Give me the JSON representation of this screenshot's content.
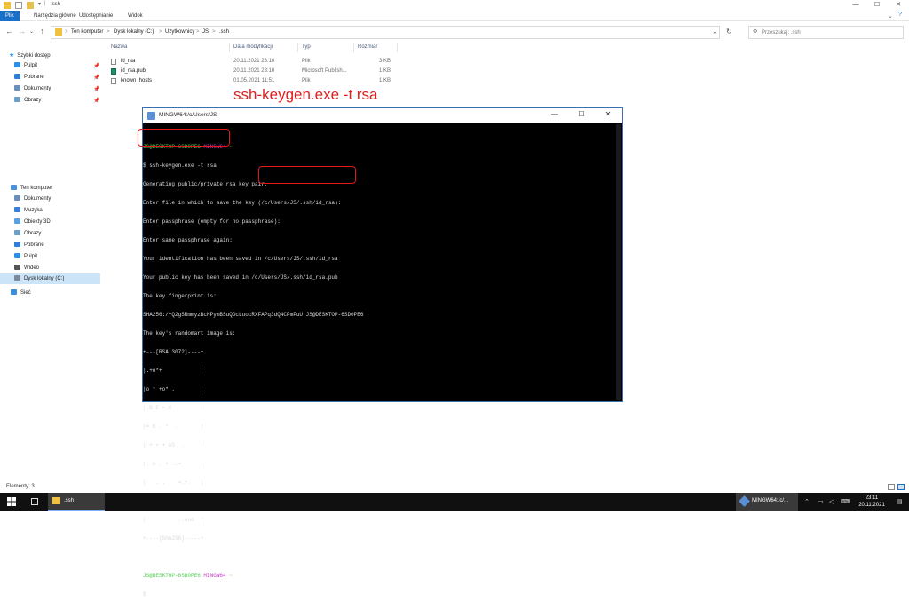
{
  "window": {
    "title": ".ssh",
    "controls": [
      "—",
      "☐",
      "✕"
    ]
  },
  "ribbon": {
    "tabs": [
      "Plik",
      "Narzędzia główne",
      "Udostępnianie",
      "Widok"
    ]
  },
  "address": {
    "crumbs": [
      "Ten komputer",
      "Dysk lokalny (C:)",
      "Użytkownicy",
      "JS",
      ".ssh"
    ],
    "separator": ">",
    "search_placeholder": "Przeszukaj: .ssh"
  },
  "sidebar": {
    "quick_access_label": "Szybki dostęp",
    "quick_access": [
      {
        "label": "Pulpit",
        "icon": "desktop-icon",
        "color": "#2f8fe8",
        "pinned": true
      },
      {
        "label": "Pobrane",
        "icon": "download-icon",
        "color": "#2f7fd8",
        "pinned": true
      },
      {
        "label": "Dokumenty",
        "icon": "documents-icon",
        "color": "#6a8fb8",
        "pinned": true
      },
      {
        "label": "Obrazy",
        "icon": "pictures-icon",
        "color": "#6a9fc8",
        "pinned": true
      }
    ],
    "pin_glyph": "📌",
    "this_pc_label": "Ten komputer",
    "this_pc": [
      {
        "label": "Dokumenty",
        "icon": "documents-icon",
        "color": "#6a8fb8"
      },
      {
        "label": "Muzyka",
        "icon": "music-icon",
        "color": "#3a7fd8"
      },
      {
        "label": "Obiekty 3D",
        "icon": "objects-3d-icon",
        "color": "#5aa0e0"
      },
      {
        "label": "Obrazy",
        "icon": "pictures-icon",
        "color": "#6a9fc8"
      },
      {
        "label": "Pobrane",
        "icon": "download-icon",
        "color": "#2f7fd8"
      },
      {
        "label": "Pulpit",
        "icon": "desktop-icon",
        "color": "#2f8fe8"
      },
      {
        "label": "Wideo",
        "icon": "video-icon",
        "color": "#555555"
      },
      {
        "label": "Dysk lokalny (C:)",
        "icon": "drive-icon",
        "color": "#7a8a9a",
        "selected": true
      }
    ],
    "network_label": "Sieć"
  },
  "files": {
    "columns": [
      "Nazwa",
      "Data modyfikacji",
      "Typ",
      "Rozmiar"
    ],
    "rows": [
      {
        "name": "id_rsa",
        "date": "20.11.2021 23:10",
        "type": "Plik",
        "size": "3 KB"
      },
      {
        "name": "id_rsa.pub",
        "date": "20.11.2021 23:10",
        "type": "Microsoft Publish...",
        "size": "1 KB"
      },
      {
        "name": "known_hosts",
        "date": "01.05.2021 11:51",
        "type": "Plik",
        "size": "1 KB"
      }
    ]
  },
  "annotation": "ssh-keygen.exe -t rsa",
  "terminal": {
    "title": "MINGW64:/c/Users/JS",
    "controls": [
      "—",
      "☐",
      "✕"
    ],
    "prompt_user": "JS@DESKTOP-6SD0PE6",
    "prompt_env": "MINGW64",
    "prompt_dir": "~",
    "lines": [
      "$ ssh-keygen.exe -t rsa",
      "Generating public/private rsa key pair.",
      "Enter file in which to save the key (/c/Users/JS/.ssh/id_rsa):",
      "Enter passphrase (empty for no passphrase):",
      "Enter same passphrase again:",
      "Your identification has been saved in /c/Users/JS/.ssh/id_rsa",
      "Your public key has been saved in /c/Users/JS/.ssh/id_rsa.pub",
      "The key fingerprint is:",
      "SHA256:/+Q2gSRmmyzBcHPymBSuQDcLuocRXFAPq3dQ4CPmFuU JS@DESKTOP-6SD0PE6",
      "The key's randomart image is:",
      "+---[RSA 3072]----+",
      "|.+o*+            |",
      "|o * +o* .        |",
      "|.B E =.X         |",
      "|= B . *  .       |",
      "| + + + oS  .     |",
      "|. o . + ..=      |",
      "|   . .    =.+.   |",
      "|        . +++    |",
      "|          ..ooo  |",
      "+----[SHA256]-----+"
    ],
    "cursor_line": "$"
  },
  "statusbar": {
    "items_text": "Elementy: 3"
  },
  "taskbar": {
    "explorer_label": ".ssh",
    "mingw_label": "MINGW64:/c/...",
    "time": "23:11",
    "date": "20.11.2021"
  }
}
